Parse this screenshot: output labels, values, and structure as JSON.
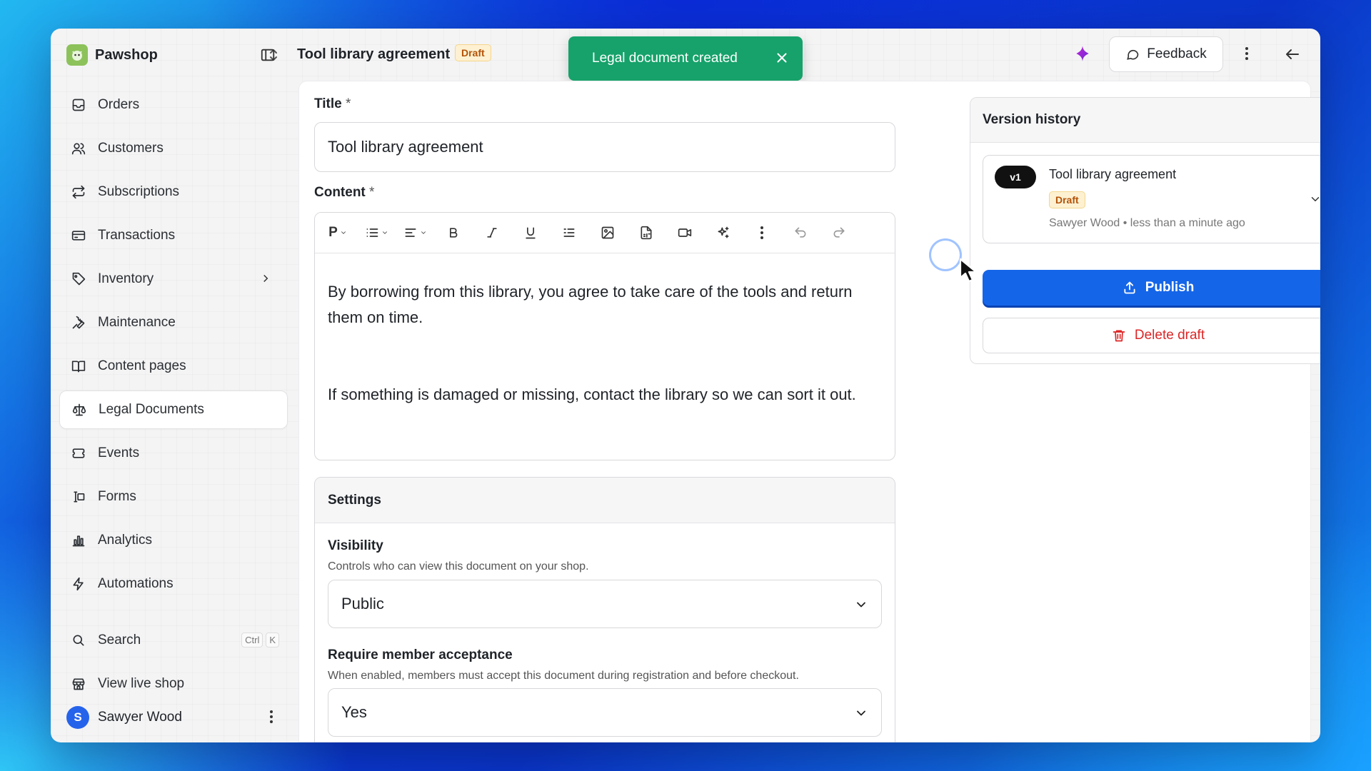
{
  "brand": {
    "name": "Pawshop"
  },
  "sidebar": {
    "items": [
      {
        "label": "Orders",
        "icon": "inbox-icon"
      },
      {
        "label": "Customers",
        "icon": "users-icon"
      },
      {
        "label": "Subscriptions",
        "icon": "repeat-icon"
      },
      {
        "label": "Transactions",
        "icon": "credit-card-icon"
      },
      {
        "label": "Inventory",
        "icon": "tag-icon"
      },
      {
        "label": "Maintenance",
        "icon": "wrench-icon"
      },
      {
        "label": "Content pages",
        "icon": "book-icon"
      },
      {
        "label": "Legal Documents",
        "icon": "scale-icon",
        "active": true
      },
      {
        "label": "Events",
        "icon": "ticket-icon"
      },
      {
        "label": "Forms",
        "icon": "form-icon"
      },
      {
        "label": "Analytics",
        "icon": "bar-chart-icon"
      },
      {
        "label": "Automations",
        "icon": "zap-icon"
      }
    ],
    "search": {
      "label": "Search",
      "kbd": [
        "Ctrl",
        "K"
      ]
    },
    "live_shop": {
      "label": "View live shop"
    },
    "user": {
      "initial": "S",
      "name": "Sawyer Wood"
    }
  },
  "header": {
    "title": "Tool library agreement",
    "status_badge": "Draft",
    "feedback_label": "Feedback"
  },
  "toast": {
    "message": "Legal document created",
    "color": "#16a26a"
  },
  "form": {
    "title_label": "Title",
    "required_mark": "*",
    "title_value": "Tool library agreement",
    "content_label": "Content",
    "toolbar": {
      "paragraph": "P"
    },
    "content_paragraphs": [
      "By borrowing from this library, you agree to take care of the tools and return them on time.",
      "If something is damaged or missing, contact the library so we can sort it out."
    ]
  },
  "settings": {
    "heading": "Settings",
    "visibility": {
      "label": "Visibility",
      "help": "Controls who can view this document on your shop.",
      "value": "Public"
    },
    "acceptance": {
      "label": "Require member acceptance",
      "help": "When enabled, members must accept this document during registration and before checkout.",
      "value": "Yes"
    }
  },
  "version_history": {
    "heading": "Version history",
    "versions": [
      {
        "tag": "v1",
        "title": "Tool library agreement",
        "status": "Draft",
        "meta": "Sawyer Wood • less than a minute ago"
      }
    ],
    "publish_label": "Publish",
    "delete_label": "Delete draft"
  },
  "colors": {
    "accent": "#1565e8",
    "danger": "#dc2626",
    "success": "#16a26a",
    "draft_bg": "#fdf1d2"
  }
}
